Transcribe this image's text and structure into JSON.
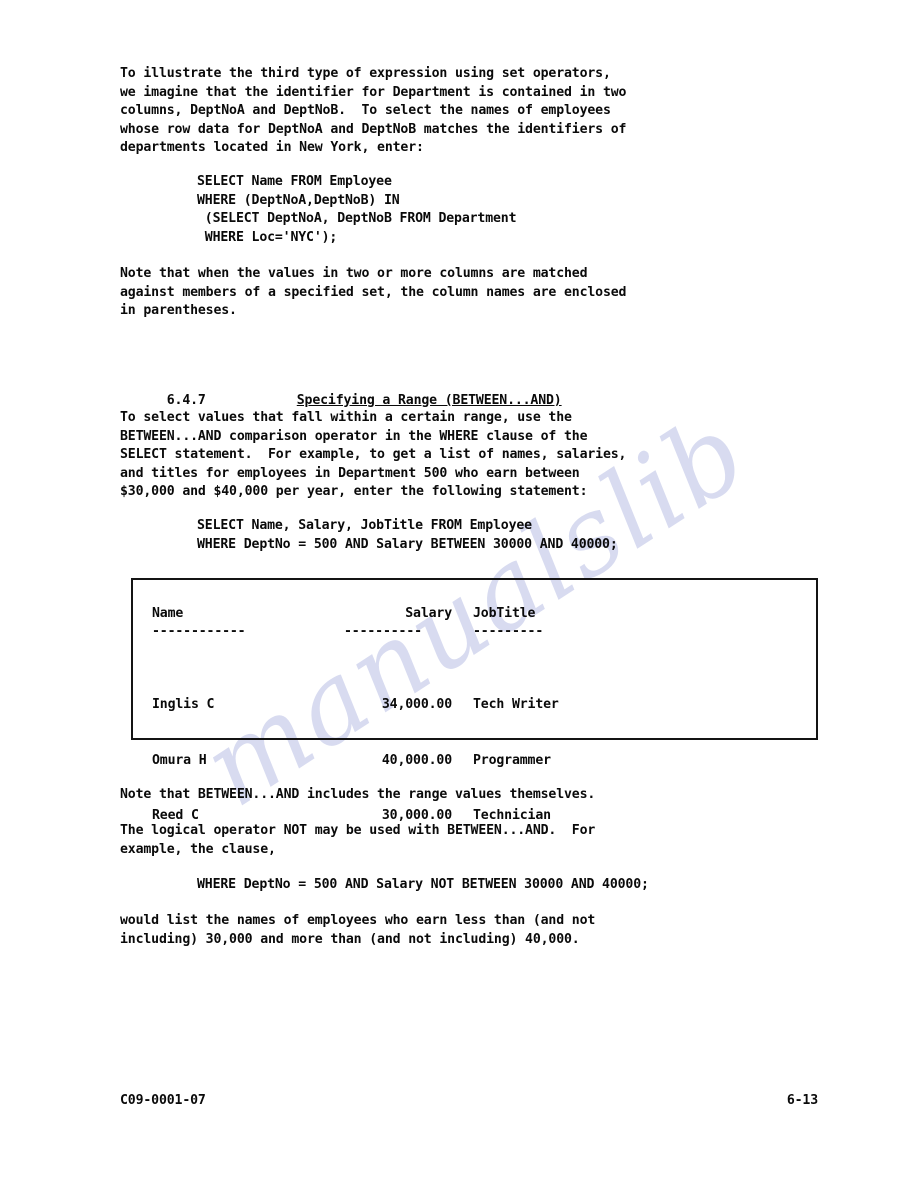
{
  "document": {
    "watermark_text": "manualslib",
    "footer": {
      "doc_number": "C09-0001-07",
      "page_number": "6-13"
    }
  },
  "body": {
    "para_1": "To illustrate the third type of expression using set operators,\nwe imagine that the identifier for Department is contained in two\ncolumns, DeptNoA and DeptNoB.  To select the names of employees\nwhose row data for DeptNoA and DeptNoB matches the identifiers of\ndepartments located in New York, enter:",
    "code_1": "SELECT Name FROM Employee\nWHERE (DeptNoA,DeptNoB) IN\n (SELECT DeptNoA, DeptNoB FROM Department\n WHERE Loc='NYC');",
    "para_2": "Note that when the values in two or more columns are matched\nagainst members of a specified set, the column names are enclosed\nin parentheses.",
    "section": {
      "number": "6.4.7",
      "title": "Specifying a Range (BETWEEN...AND)"
    },
    "para_3": "To select values that fall within a certain range, use the\nBETWEEN...AND comparison operator in the WHERE clause of the\nSELECT statement.  For example, to get a list of names, salaries,\nand titles for employees in Department 500 who earn between\n$30,000 and $40,000 per year, enter the following statement:",
    "code_2": "SELECT Name, Salary, JobTitle FROM Employee\nWHERE DeptNo = 500 AND Salary BETWEEN 30000 AND 40000;",
    "para_4": "Note that BETWEEN...AND includes the range values themselves.",
    "para_5": "The logical operator NOT may be used with BETWEEN...AND.  For\nexample, the clause,",
    "code_3": "WHERE DeptNo = 500 AND Salary NOT BETWEEN 30000 AND 40000;",
    "para_6": "would list the names of employees who earn less than (and not\nincluding) 30,000 and more than (and not including) 40,000."
  },
  "result_table": {
    "headers": {
      "name": "Name",
      "salary": "Salary",
      "jobtitle": "JobTitle"
    },
    "rules": {
      "name": "------------",
      "salary": "----------",
      "jobtitle": "---------"
    },
    "rows": [
      {
        "name": "Inglis C",
        "salary": "34,000.00",
        "jobtitle": "Tech Writer"
      },
      {
        "name": "Omura H",
        "salary": "40,000.00",
        "jobtitle": "Programmer"
      },
      {
        "name": "Reed C",
        "salary": "30,000.00",
        "jobtitle": "Technician"
      }
    ]
  }
}
